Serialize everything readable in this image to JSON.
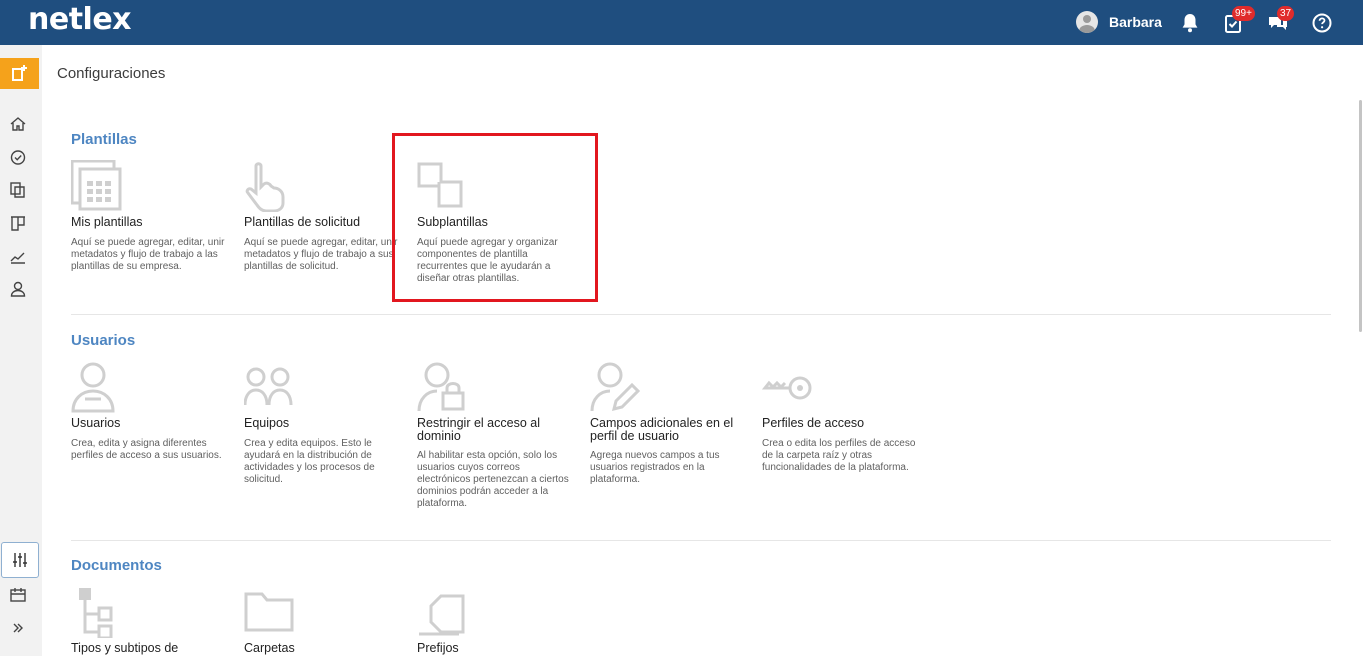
{
  "header": {
    "logo": "netlex",
    "user_name": "Barbara",
    "tasks_badge": "99+",
    "messages_badge": "37"
  },
  "sidebar": {
    "items": [
      "new-icon",
      "home-icon",
      "tasks-icon",
      "documents-icon",
      "board-icon",
      "chart-icon",
      "user-icon",
      "settings-sliders-icon",
      "calendar-icon",
      "expand-icon"
    ],
    "active": "settings-sliders-icon"
  },
  "page": {
    "title": "Configuraciones"
  },
  "sections": [
    {
      "title": "Plantillas",
      "cards": [
        {
          "title": "Mis plantillas",
          "desc": "Aquí se puede agregar, editar, unir metadatos y flujo de trabajo a las plantillas de su empresa."
        },
        {
          "title": "Plantillas de solicitud",
          "desc": "Aquí se puede agregar, editar, unir metadatos y flujo de trabajo a sus plantillas de solicitud."
        },
        {
          "title": "Subplantillas",
          "desc": "Aquí puede agregar y organizar componentes de plantilla recurrentes que le ayudarán a diseñar otras plantillas."
        }
      ]
    },
    {
      "title": "Usuarios",
      "cards": [
        {
          "title": "Usuarios",
          "desc": "Crea, edita y asigna diferentes perfiles de acceso a sus usuarios."
        },
        {
          "title": "Equipos",
          "desc": "Crea y edita equipos. Esto le ayudará en la distribución de actividades y los procesos de solicitud."
        },
        {
          "title": "Restringir el acceso al dominio",
          "desc": "Al habilitar esta opción, solo los usuarios cuyos correos electrónicos pertenezcan a ciertos dominios podrán acceder a la plataforma."
        },
        {
          "title": "Campos adicionales en el perfil de usuario",
          "desc": "Agrega nuevos campos a tus usuarios registrados en la plataforma."
        },
        {
          "title": "Perfiles de acceso",
          "desc": "Crea o edita los perfiles de acceso de la carpeta raíz y otras funcionalidades de la plataforma."
        }
      ]
    },
    {
      "title": "Documentos",
      "cards": [
        {
          "title": "Tipos y subtipos de"
        },
        {
          "title": "Carpetas"
        },
        {
          "title": "Prefijos"
        }
      ]
    }
  ],
  "colors": {
    "header_bg": "#1f4e7f",
    "accent_orange": "#f5a21b",
    "section_title": "#4e86c2",
    "badge_red": "#e02b2b",
    "highlight_red": "#e2171f",
    "icon_gray": "#cfcfcf"
  }
}
